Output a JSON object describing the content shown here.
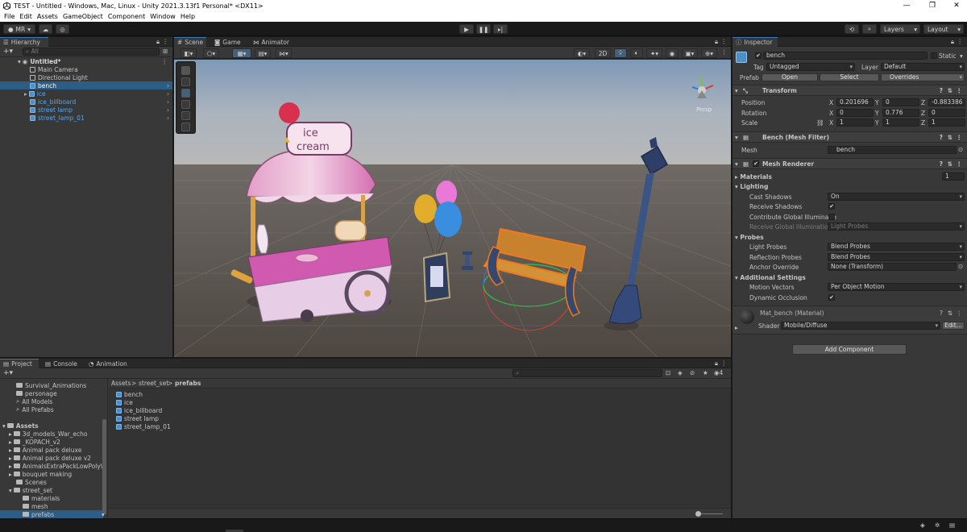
{
  "window": {
    "title": "TEST - Untitled - Windows, Mac, Linux - Unity 2021.3.13f1 Personal* <DX11>",
    "minimize": "—",
    "maximize": "❐",
    "close": "✕"
  },
  "menu": [
    "File",
    "Edit",
    "Assets",
    "GameObject",
    "Component",
    "Window",
    "Help"
  ],
  "toolbar": {
    "account": "MR",
    "layers": "Layers",
    "layout": "Layout"
  },
  "hierarchy": {
    "tab": "Hierarchy",
    "search_placeholder": "All",
    "scene": "Untitled*",
    "items": [
      {
        "label": "Main Camera",
        "type": "gameobject"
      },
      {
        "label": "Directional Light",
        "type": "gameobject"
      },
      {
        "label": "bench",
        "type": "prefab",
        "selected": true
      },
      {
        "label": "ice",
        "type": "prefab"
      },
      {
        "label": "ice_billboard",
        "type": "prefab"
      },
      {
        "label": "street lamp",
        "type": "prefab"
      },
      {
        "label": "street_lamp_01",
        "type": "prefab"
      }
    ]
  },
  "scene_tabs": [
    "Scene",
    "Game",
    "Animator"
  ],
  "scene_view": {
    "mode_2d": "2D",
    "gizmo_label": "Persp",
    "sign_text_1": "ice",
    "sign_text_2": "cream"
  },
  "project": {
    "tabs": [
      "Project",
      "Console",
      "Animation"
    ],
    "tree_top": [
      {
        "label": "Survival_Animations",
        "type": "folder"
      },
      {
        "label": "personage",
        "type": "folder"
      },
      {
        "label": "All Models",
        "type": "search"
      },
      {
        "label": "All Prefabs",
        "type": "search"
      }
    ],
    "assets_root": "Assets",
    "assets": [
      "3d_models_War_echo",
      "_KOPACH_v2",
      "Animal pack deluxe",
      "Animal pack deluxe v2",
      "AnimalsExtraPackLowPoly\\",
      "bouquet making",
      "Scenes",
      "street_set"
    ],
    "street_set_children": [
      "materials",
      "mesh",
      "prefabs"
    ],
    "breadcrumb": [
      "Assets",
      "street_set",
      "prefabs"
    ],
    "files": [
      "bench",
      "ice",
      "ice_billboard",
      "street lamp",
      "street_lamp_01"
    ],
    "hidden_count": "4"
  },
  "inspector": {
    "tab": "Inspector",
    "object_name": "bench",
    "static_label": "Static",
    "tag_label": "Tag",
    "tag_value": "Untagged",
    "layer_label": "Layer",
    "layer_value": "Default",
    "prefab_label": "Prefab",
    "prefab_open": "Open",
    "prefab_select": "Select",
    "prefab_overrides": "Overrides",
    "transform": {
      "title": "Transform",
      "position_label": "Position",
      "rotation_label": "Rotation",
      "scale_label": "Scale",
      "position": {
        "x": "0.201696",
        "y": "0",
        "z": "-0.883386"
      },
      "rotation": {
        "x": "0",
        "y": "0.776",
        "z": "0"
      },
      "scale": {
        "x": "1",
        "y": "1",
        "z": "1"
      }
    },
    "mesh_filter": {
      "title": "Bench  (Mesh Filter)",
      "mesh_label": "Mesh",
      "mesh_value": "bench"
    },
    "mesh_renderer": {
      "title": "Mesh Renderer",
      "materials_label": "Materials",
      "materials_count": "1",
      "lighting_label": "Lighting",
      "cast_shadows_label": "Cast Shadows",
      "cast_shadows_value": "On",
      "receive_shadows_label": "Receive Shadows",
      "contribute_gi_label": "Contribute Global Illuminatio",
      "receive_gi_label": "Receive Global Illumination",
      "receive_gi_value": "Light Probes",
      "probes_label": "Probes",
      "light_probes_label": "Light Probes",
      "light_probes_value": "Blend Probes",
      "reflection_probes_label": "Reflection Probes",
      "reflection_probes_value": "Blend Probes",
      "anchor_override_label": "Anchor Override",
      "anchor_override_value": "None (Transform)",
      "additional_label": "Additional Settings",
      "motion_vectors_label": "Motion Vectors",
      "motion_vectors_value": "Per Object Motion",
      "dynamic_occlusion_label": "Dynamic Occlusion"
    },
    "material": {
      "title": "Mat_bench (Material)",
      "shader_label": "Shader",
      "shader_value": "Mobile/Diffuse",
      "edit_label": "Edit..."
    },
    "add_component": "Add Component"
  },
  "colors": {
    "accent": "#2c5d87",
    "prefab_blue": "#5aa5e8",
    "panel": "#383838"
  }
}
